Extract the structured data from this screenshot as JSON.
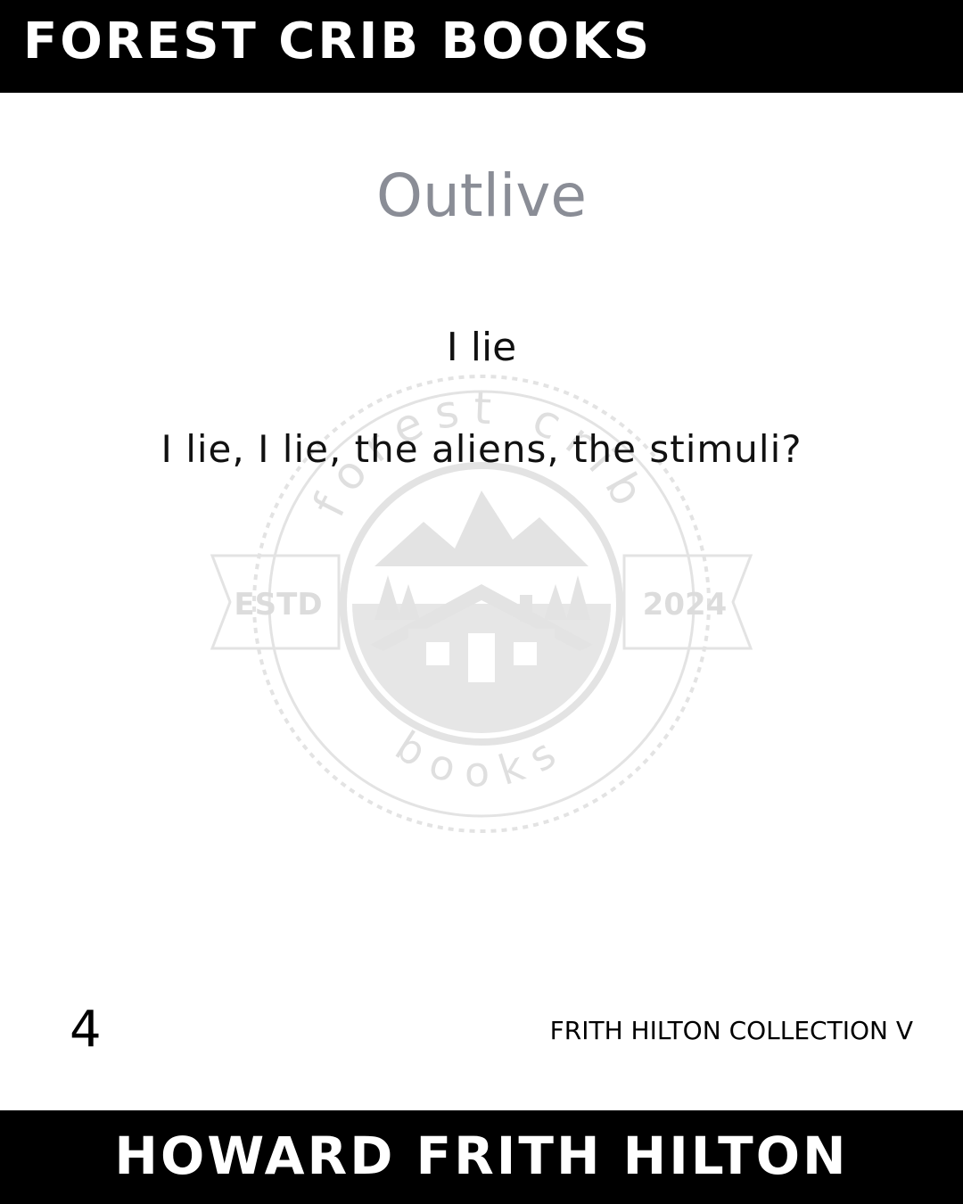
{
  "header": {
    "brand": "FOREST CRIB BOOKS"
  },
  "poem": {
    "title": "Outlive",
    "lines": [
      "I lie",
      "I lie, I lie, the aliens, the stimuli?"
    ]
  },
  "watermark": {
    "top_text": "forest crib",
    "left_banner": "ESTD",
    "right_banner": "2024",
    "bottom_text": "books"
  },
  "footer": {
    "page_number": "4",
    "collection": "FRITH HILTON COLLECTION V",
    "author": "HOWARD FRITH HILTON"
  }
}
